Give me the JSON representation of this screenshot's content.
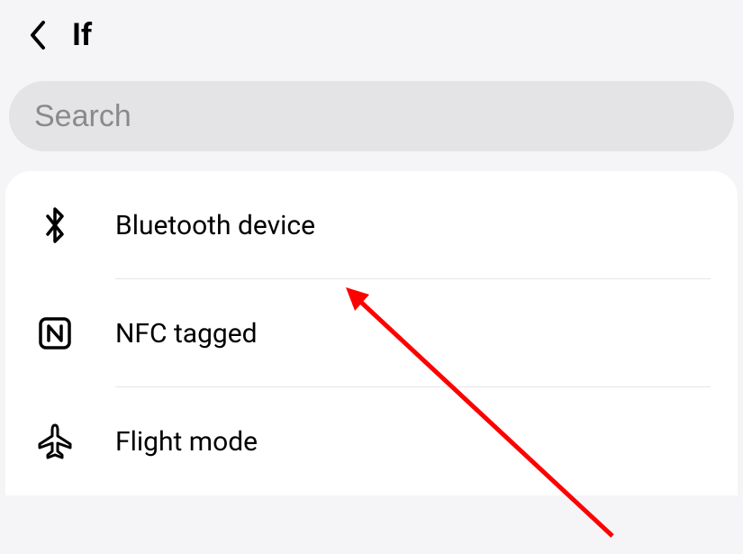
{
  "header": {
    "title": "If"
  },
  "search": {
    "placeholder": "Search",
    "value": ""
  },
  "items": [
    {
      "label": "Bluetooth device",
      "icon": "bluetooth-icon"
    },
    {
      "label": "NFC tagged",
      "icon": "nfc-icon"
    },
    {
      "label": "Flight mode",
      "icon": "airplane-icon"
    }
  ],
  "annotation": {
    "color": "#ff0000"
  }
}
